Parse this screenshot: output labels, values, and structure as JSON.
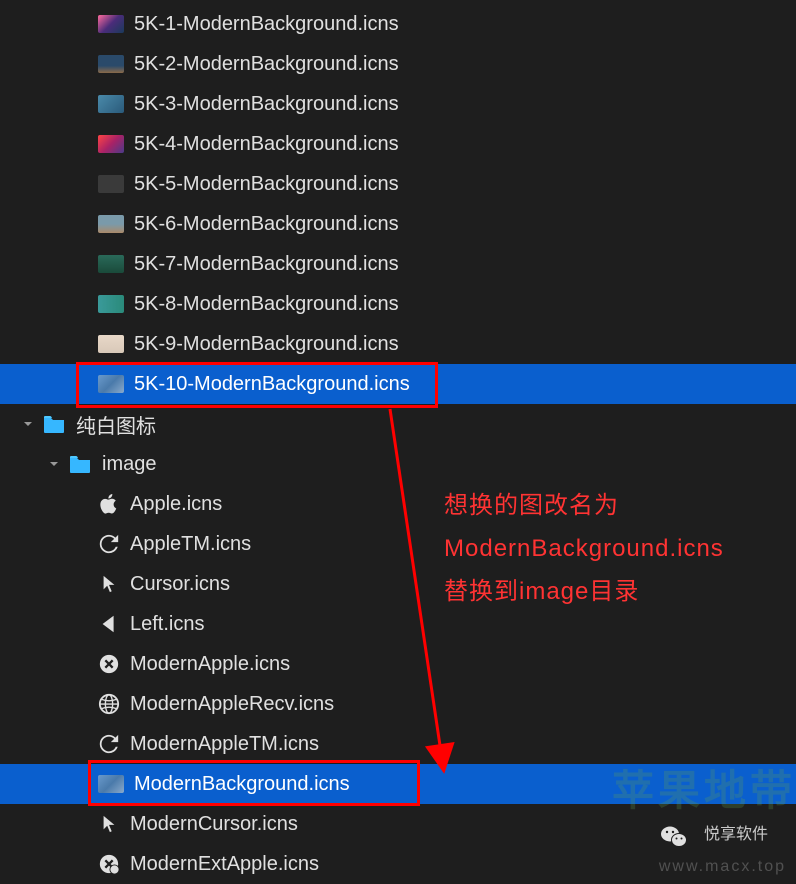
{
  "tree": {
    "bg_files": [
      {
        "name": "5K-1-ModernBackground.icns",
        "thumb": "t1"
      },
      {
        "name": "5K-2-ModernBackground.icns",
        "thumb": "t2"
      },
      {
        "name": "5K-3-ModernBackground.icns",
        "thumb": "t3"
      },
      {
        "name": "5K-4-ModernBackground.icns",
        "thumb": "t4"
      },
      {
        "name": "5K-5-ModernBackground.icns",
        "thumb": "t5"
      },
      {
        "name": "5K-6-ModernBackground.icns",
        "thumb": "t6"
      },
      {
        "name": "5K-7-ModernBackground.icns",
        "thumb": "t7"
      },
      {
        "name": "5K-8-ModernBackground.icns",
        "thumb": "t8"
      },
      {
        "name": "5K-9-ModernBackground.icns",
        "thumb": "t9"
      },
      {
        "name": "5K-10-ModernBackground.icns",
        "thumb": "t10",
        "selected": true
      }
    ],
    "folder1": {
      "name": "纯白图标"
    },
    "folder2": {
      "name": "image"
    },
    "image_files": [
      {
        "name": "Apple.icns",
        "icon": "apple"
      },
      {
        "name": "AppleTM.icns",
        "icon": "refresh"
      },
      {
        "name": "Cursor.icns",
        "icon": "cursor"
      },
      {
        "name": "Left.icns",
        "icon": "left"
      },
      {
        "name": "ModernApple.icns",
        "icon": "circle-x"
      },
      {
        "name": "ModernAppleRecv.icns",
        "icon": "globe"
      },
      {
        "name": "ModernAppleTM.icns",
        "icon": "refresh"
      },
      {
        "name": "ModernBackground.icns",
        "icon": "thumb",
        "thumb": "t10",
        "selected": true
      },
      {
        "name": "ModernCursor.icns",
        "icon": "cursor"
      },
      {
        "name": "ModernExtApple.icns",
        "icon": "circle-dot"
      }
    ]
  },
  "annotation": {
    "line1": "想换的图改名为",
    "line2": "ModernBackground.icns",
    "line3": "替换到image目录"
  },
  "watermark": {
    "brand": "悦享软件",
    "domain": "www.macx.top",
    "bg": "苹果地带"
  }
}
